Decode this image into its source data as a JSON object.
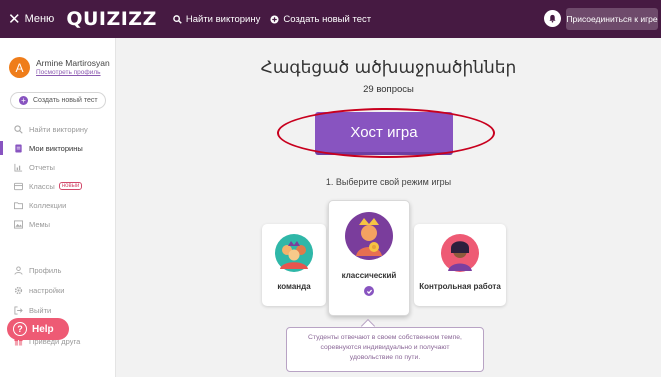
{
  "header": {
    "menu_label": "Меню",
    "logo_text": "QUIZIZZ",
    "find_quiz": "Найти викторину",
    "create_test": "Создать новый тест",
    "join_game": "Присоединиться к игре"
  },
  "sidebar": {
    "user_name": "Armine Martirosyan",
    "view_profile": "Посмотреть профиль",
    "avatar_letter": "A",
    "create_new": "Создать новый тест",
    "items": [
      {
        "label": "Найти викторину"
      },
      {
        "label": "Мои викторины"
      },
      {
        "label": "Отчеты"
      },
      {
        "label": "Классы",
        "badge": "новый"
      },
      {
        "label": "Коллекции"
      },
      {
        "label": "Мемы"
      },
      {
        "label": "Профиль"
      },
      {
        "label": "настройки"
      },
      {
        "label": "Выйти"
      },
      {
        "label": "Приведи друга"
      }
    ],
    "help": "Help"
  },
  "main": {
    "quiz_title": "Հագեցած ածխաջրածիններ",
    "question_count": "29 вопросы",
    "host_button": "Хост игра",
    "mode_prompt": "1. Выберите свой режим игры",
    "modes": [
      {
        "label": "команда"
      },
      {
        "label": "классический"
      },
      {
        "label": "Контрольная работа"
      }
    ],
    "tooltip_lines": [
      "Студенты отвечают в своем собственном темпе,",
      "соревнуются индивидуально и получают",
      "удовольствие по пути."
    ]
  },
  "colors": {
    "header_bg": "#461a42",
    "accent": "#8854c0",
    "annotation": "#c8001e",
    "help": "#ee5a74"
  }
}
